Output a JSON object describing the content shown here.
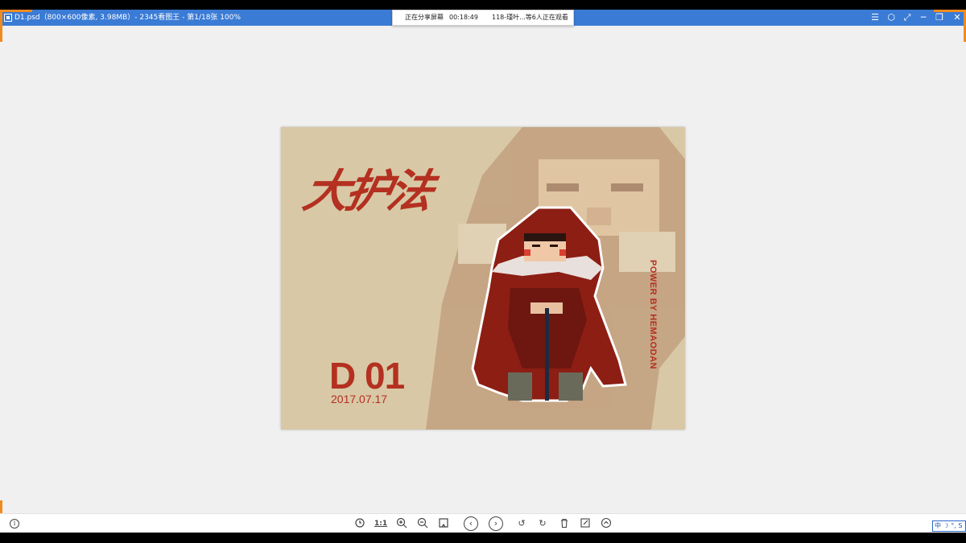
{
  "window": {
    "title": "D1.psd（800×600像素, 3.98MB）- 2345看图王 - 第1/18张 100%",
    "controls": [
      "☰",
      "⬡",
      "⤢",
      "─",
      "❐",
      "✕"
    ]
  },
  "share_bar": {
    "status": "正在分享屏幕",
    "timer": "00:18:49",
    "viewers": "118-瑾叶...等6人正在观看"
  },
  "poster": {
    "title": "大护法",
    "code": "D 01",
    "date": "2017.07.17",
    "credit": "POWER BY HEMAODAN"
  },
  "toolbar": {
    "info_glyph": "i",
    "actual_size_label": "1:1"
  },
  "ime": {
    "text": "中 ☽ °, S"
  },
  "colors": {
    "titlebar": "#3a7bd5",
    "poster_bg": "#d8c8a6",
    "poster_red": "#b43020",
    "accent_orange": "#f08a1c"
  }
}
